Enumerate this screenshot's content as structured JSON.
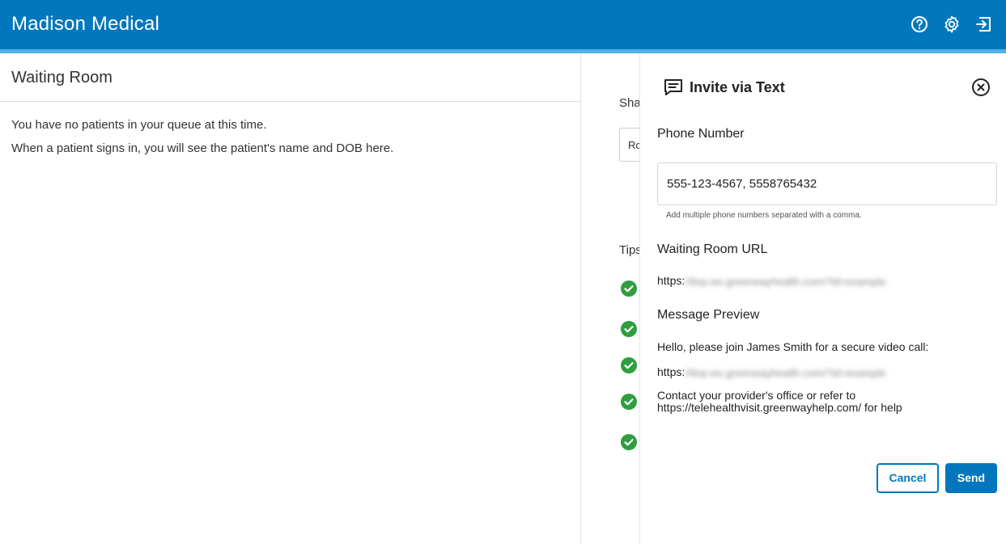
{
  "header": {
    "app_title": "Madison Medical",
    "icons": [
      "help-circle-icon",
      "gear-icon",
      "sign-out-icon"
    ],
    "bg_color": "#0277bd",
    "stripe_color": "#4fb3e8"
  },
  "main": {
    "page_title": "Waiting Room",
    "empty_line_1": "You have no patients in your queue at this time.",
    "empty_line_2": "When a patient signs in, you will see the patient's name and DOB here."
  },
  "behind_panel": {
    "share_label": "Sha",
    "room_value": "Ro",
    "tips_label": "Tips",
    "check_count": 5,
    "check_color": "#2e9e3e"
  },
  "invite_panel": {
    "title": "Invite via Text",
    "title_icon": "message-icon",
    "close_icon": "close-circle-icon",
    "phone_label": "Phone Number",
    "phone_value": "555-123-4567, 5558765432",
    "phone_hint": "Add multiple phone numbers separated with a comma.",
    "url_label": "Waiting Room URL",
    "url_prefix": "https:",
    "url_blurred": "//tlvp.ws.greenwayhealth.com/?id=example",
    "preview_label": "Message Preview",
    "preview_greeting": "Hello, please join James Smith for a secure video call:",
    "preview_url_prefix": "https:",
    "preview_url_blurred": "//tlvp.ws.greenwayhealth.com/?id=example",
    "preview_help_line_1": "Contact your provider's office or refer to",
    "preview_help_line_2": "https://telehealthvisit.greenwayhelp.com/ for help",
    "cancel_label": "Cancel",
    "send_label": "Send",
    "accent_color": "#0277bd"
  }
}
